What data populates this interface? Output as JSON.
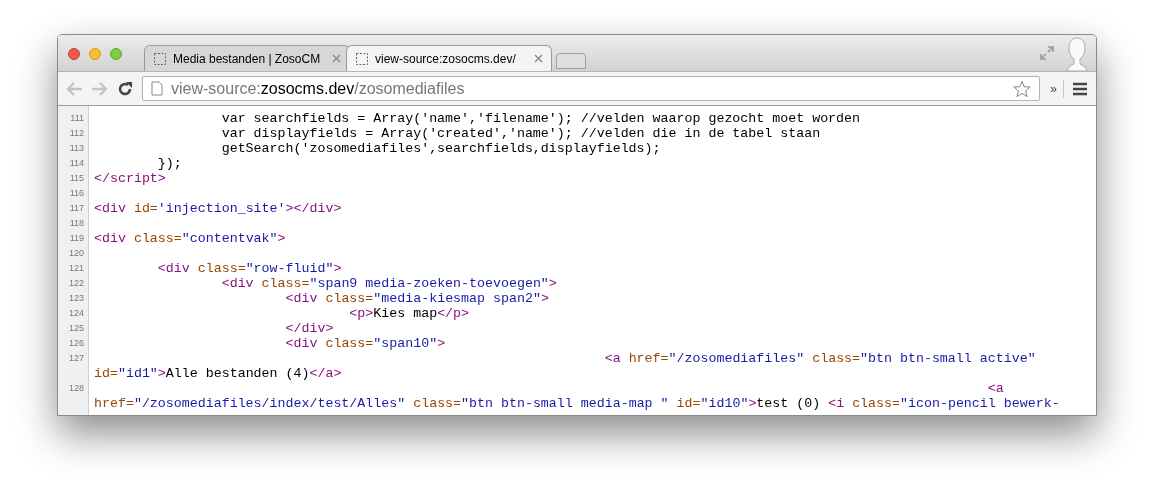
{
  "window": {
    "tabs": [
      {
        "title": "Media bestanden | ZosoCM",
        "selected": false
      },
      {
        "title": "view-source:zosocms.dev/",
        "selected": true
      }
    ],
    "toolbar": {
      "back_disabled": true,
      "forward_disabled": true,
      "url": [
        {
          "kind": "scheme",
          "text": "view-source:"
        },
        {
          "kind": "host",
          "text": "zosocms.dev"
        },
        {
          "kind": "path",
          "text": "/zosomediafiles"
        }
      ],
      "overflow": "»"
    }
  },
  "source": {
    "lines": [
      {
        "number": "111",
        "rows": [
          {
            "segments": [
              {
                "kind": "text",
                "text": "\t\tvar searchfields = Array('name','filename'); //velden waarop gezocht moet worden"
              }
            ]
          }
        ]
      },
      {
        "number": "112",
        "rows": [
          {
            "segments": [
              {
                "kind": "text",
                "text": "\t\tvar displayfields = Array('created','name'); //velden die in de tabel staan"
              }
            ]
          }
        ]
      },
      {
        "number": "113",
        "rows": [
          {
            "segments": [
              {
                "kind": "text",
                "text": "\t\tgetSearch('zosomediafiles',searchfields,displayfields);"
              }
            ]
          }
        ]
      },
      {
        "number": "114",
        "rows": [
          {
            "segments": [
              {
                "kind": "text",
                "text": "\t});"
              }
            ]
          }
        ]
      },
      {
        "number": "115",
        "rows": [
          {
            "segments": [
              {
                "kind": "tag",
                "text": "</script>"
              }
            ]
          }
        ]
      },
      {
        "number": "116",
        "rows": [
          {
            "segments": []
          }
        ]
      },
      {
        "number": "117",
        "rows": [
          {
            "segments": [
              {
                "kind": "tag",
                "text": "<div "
              },
              {
                "kind": "attr",
                "text": "id="
              },
              {
                "kind": "value",
                "text": "'injection_site'"
              },
              {
                "kind": "tag",
                "text": "></div>"
              }
            ]
          }
        ]
      },
      {
        "number": "118",
        "rows": [
          {
            "segments": []
          }
        ]
      },
      {
        "number": "119",
        "rows": [
          {
            "segments": [
              {
                "kind": "tag",
                "text": "<div "
              },
              {
                "kind": "attr",
                "text": "class="
              },
              {
                "kind": "value",
                "text": "\"contentvak\""
              },
              {
                "kind": "tag",
                "text": ">"
              }
            ]
          }
        ]
      },
      {
        "number": "120",
        "rows": [
          {
            "segments": []
          }
        ]
      },
      {
        "number": "121",
        "rows": [
          {
            "segments": [
              {
                "kind": "tag",
                "text": "\t<div "
              },
              {
                "kind": "attr",
                "text": "class="
              },
              {
                "kind": "value",
                "text": "\"row-fluid\""
              },
              {
                "kind": "tag",
                "text": ">"
              }
            ]
          }
        ]
      },
      {
        "number": "122",
        "rows": [
          {
            "segments": [
              {
                "kind": "tag",
                "text": "\t\t<div "
              },
              {
                "kind": "attr",
                "text": "class="
              },
              {
                "kind": "value",
                "text": "\"span9 media-zoeken-toevoegen\""
              },
              {
                "kind": "tag",
                "text": ">"
              }
            ]
          }
        ]
      },
      {
        "number": "123",
        "rows": [
          {
            "segments": [
              {
                "kind": "tag",
                "text": "\t\t\t<div "
              },
              {
                "kind": "attr",
                "text": "class="
              },
              {
                "kind": "value",
                "text": "\"media-kiesmap span2\""
              },
              {
                "kind": "tag",
                "text": ">"
              }
            ]
          }
        ]
      },
      {
        "number": "124",
        "rows": [
          {
            "segments": [
              {
                "kind": "tag",
                "text": "\t\t\t\t<p>"
              },
              {
                "kind": "text",
                "text": "Kies map"
              },
              {
                "kind": "tag",
                "text": "</p>"
              }
            ]
          }
        ]
      },
      {
        "number": "125",
        "rows": [
          {
            "segments": [
              {
                "kind": "tag",
                "text": "\t\t\t</div>"
              }
            ]
          }
        ]
      },
      {
        "number": "126",
        "rows": [
          {
            "segments": [
              {
                "kind": "tag",
                "text": "\t\t\t<div "
              },
              {
                "kind": "attr",
                "text": "class="
              },
              {
                "kind": "value",
                "text": "\"span10\""
              },
              {
                "kind": "tag",
                "text": ">"
              }
            ]
          }
        ]
      },
      {
        "number": "127",
        "rows": [
          {
            "segments": [
              {
                "kind": "tag",
                "text": "\t\t\t\t\t\t\t\t<a "
              },
              {
                "kind": "attr",
                "text": "href="
              },
              {
                "kind": "value",
                "text": "\"/zosomediafiles\" "
              },
              {
                "kind": "attr",
                "text": "class="
              },
              {
                "kind": "value",
                "text": "\"btn btn-small active\""
              }
            ]
          },
          {
            "segments": [
              {
                "kind": "attr",
                "text": "id="
              },
              {
                "kind": "value",
                "text": "\"id1\""
              },
              {
                "kind": "tag",
                "text": ">"
              },
              {
                "kind": "text",
                "text": "Alle bestanden (4)"
              },
              {
                "kind": "tag",
                "text": "</a>"
              }
            ]
          }
        ]
      },
      {
        "number": "128",
        "rows": [
          {
            "segments": [
              {
                "kind": "tag",
                "text": "\t\t\t\t\t\t\t\t\t\t\t\t\t\t<a"
              }
            ]
          },
          {
            "segments": [
              {
                "kind": "attr",
                "text": "href="
              },
              {
                "kind": "value",
                "text": "\"/zosomediafiles/index/test/Alles\" "
              },
              {
                "kind": "attr",
                "text": "class="
              },
              {
                "kind": "value",
                "text": "\"btn btn-small media-map \" "
              },
              {
                "kind": "attr",
                "text": "id="
              },
              {
                "kind": "value",
                "text": "\"id10\""
              },
              {
                "kind": "tag",
                "text": ">"
              },
              {
                "kind": "text",
                "text": "test (0) "
              },
              {
                "kind": "tag",
                "text": "<i "
              },
              {
                "kind": "attr",
                "text": "class="
              },
              {
                "kind": "value",
                "text": "\"icon-pencil bewerk-"
              }
            ]
          }
        ]
      }
    ]
  }
}
